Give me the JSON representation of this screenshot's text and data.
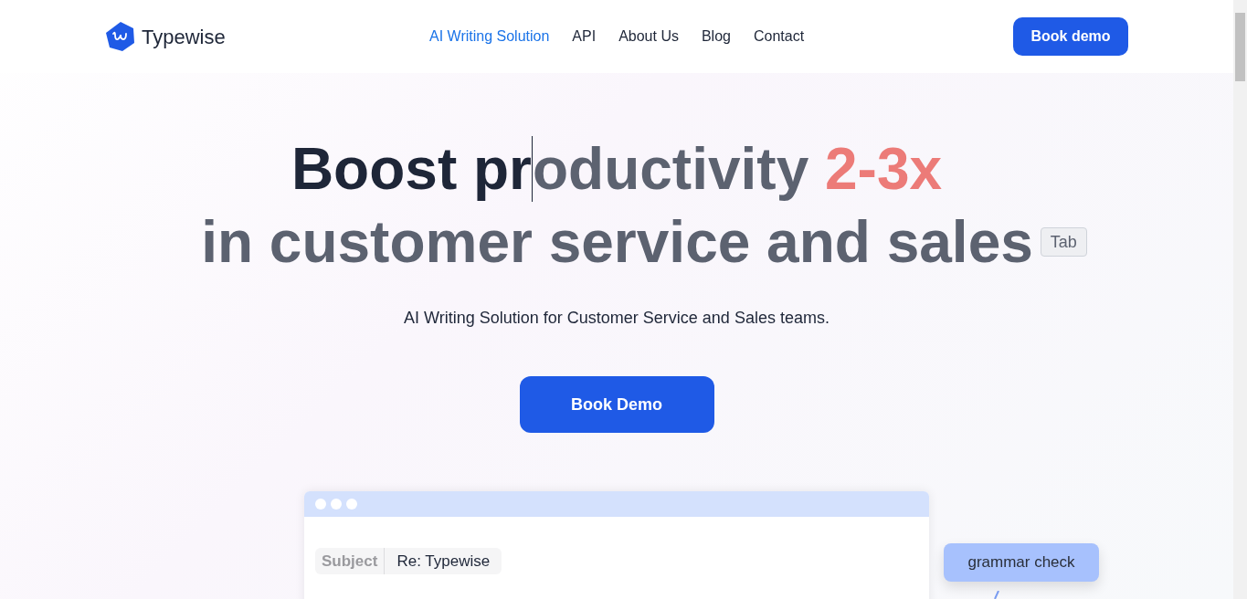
{
  "logo": {
    "text": "Typewise"
  },
  "nav": [
    {
      "label": "AI Writing Solution",
      "selected": true
    },
    {
      "label": "API",
      "selected": false
    },
    {
      "label": "About Us",
      "selected": false
    },
    {
      "label": "Blog",
      "selected": false
    },
    {
      "label": "Contact",
      "selected": false
    }
  ],
  "header_button": "Book demo",
  "headline": {
    "line1": [
      {
        "text": "Boost pr",
        "kind": "typed"
      },
      {
        "text": "oductivity ",
        "kind": "suggested"
      },
      {
        "text": "2-3x",
        "kind": "highlight"
      }
    ],
    "line2": [
      {
        "text": "in customer service and sales",
        "kind": "suggested"
      }
    ],
    "key_hint": "Tab"
  },
  "subtitle": "AI Writing Solution for Customer Service and Sales teams.",
  "cta_button": "Book Demo",
  "email_window": {
    "subject_label": "Subject",
    "subject_value": "Re: Typewise"
  },
  "suggestion_chip": "grammar check"
}
